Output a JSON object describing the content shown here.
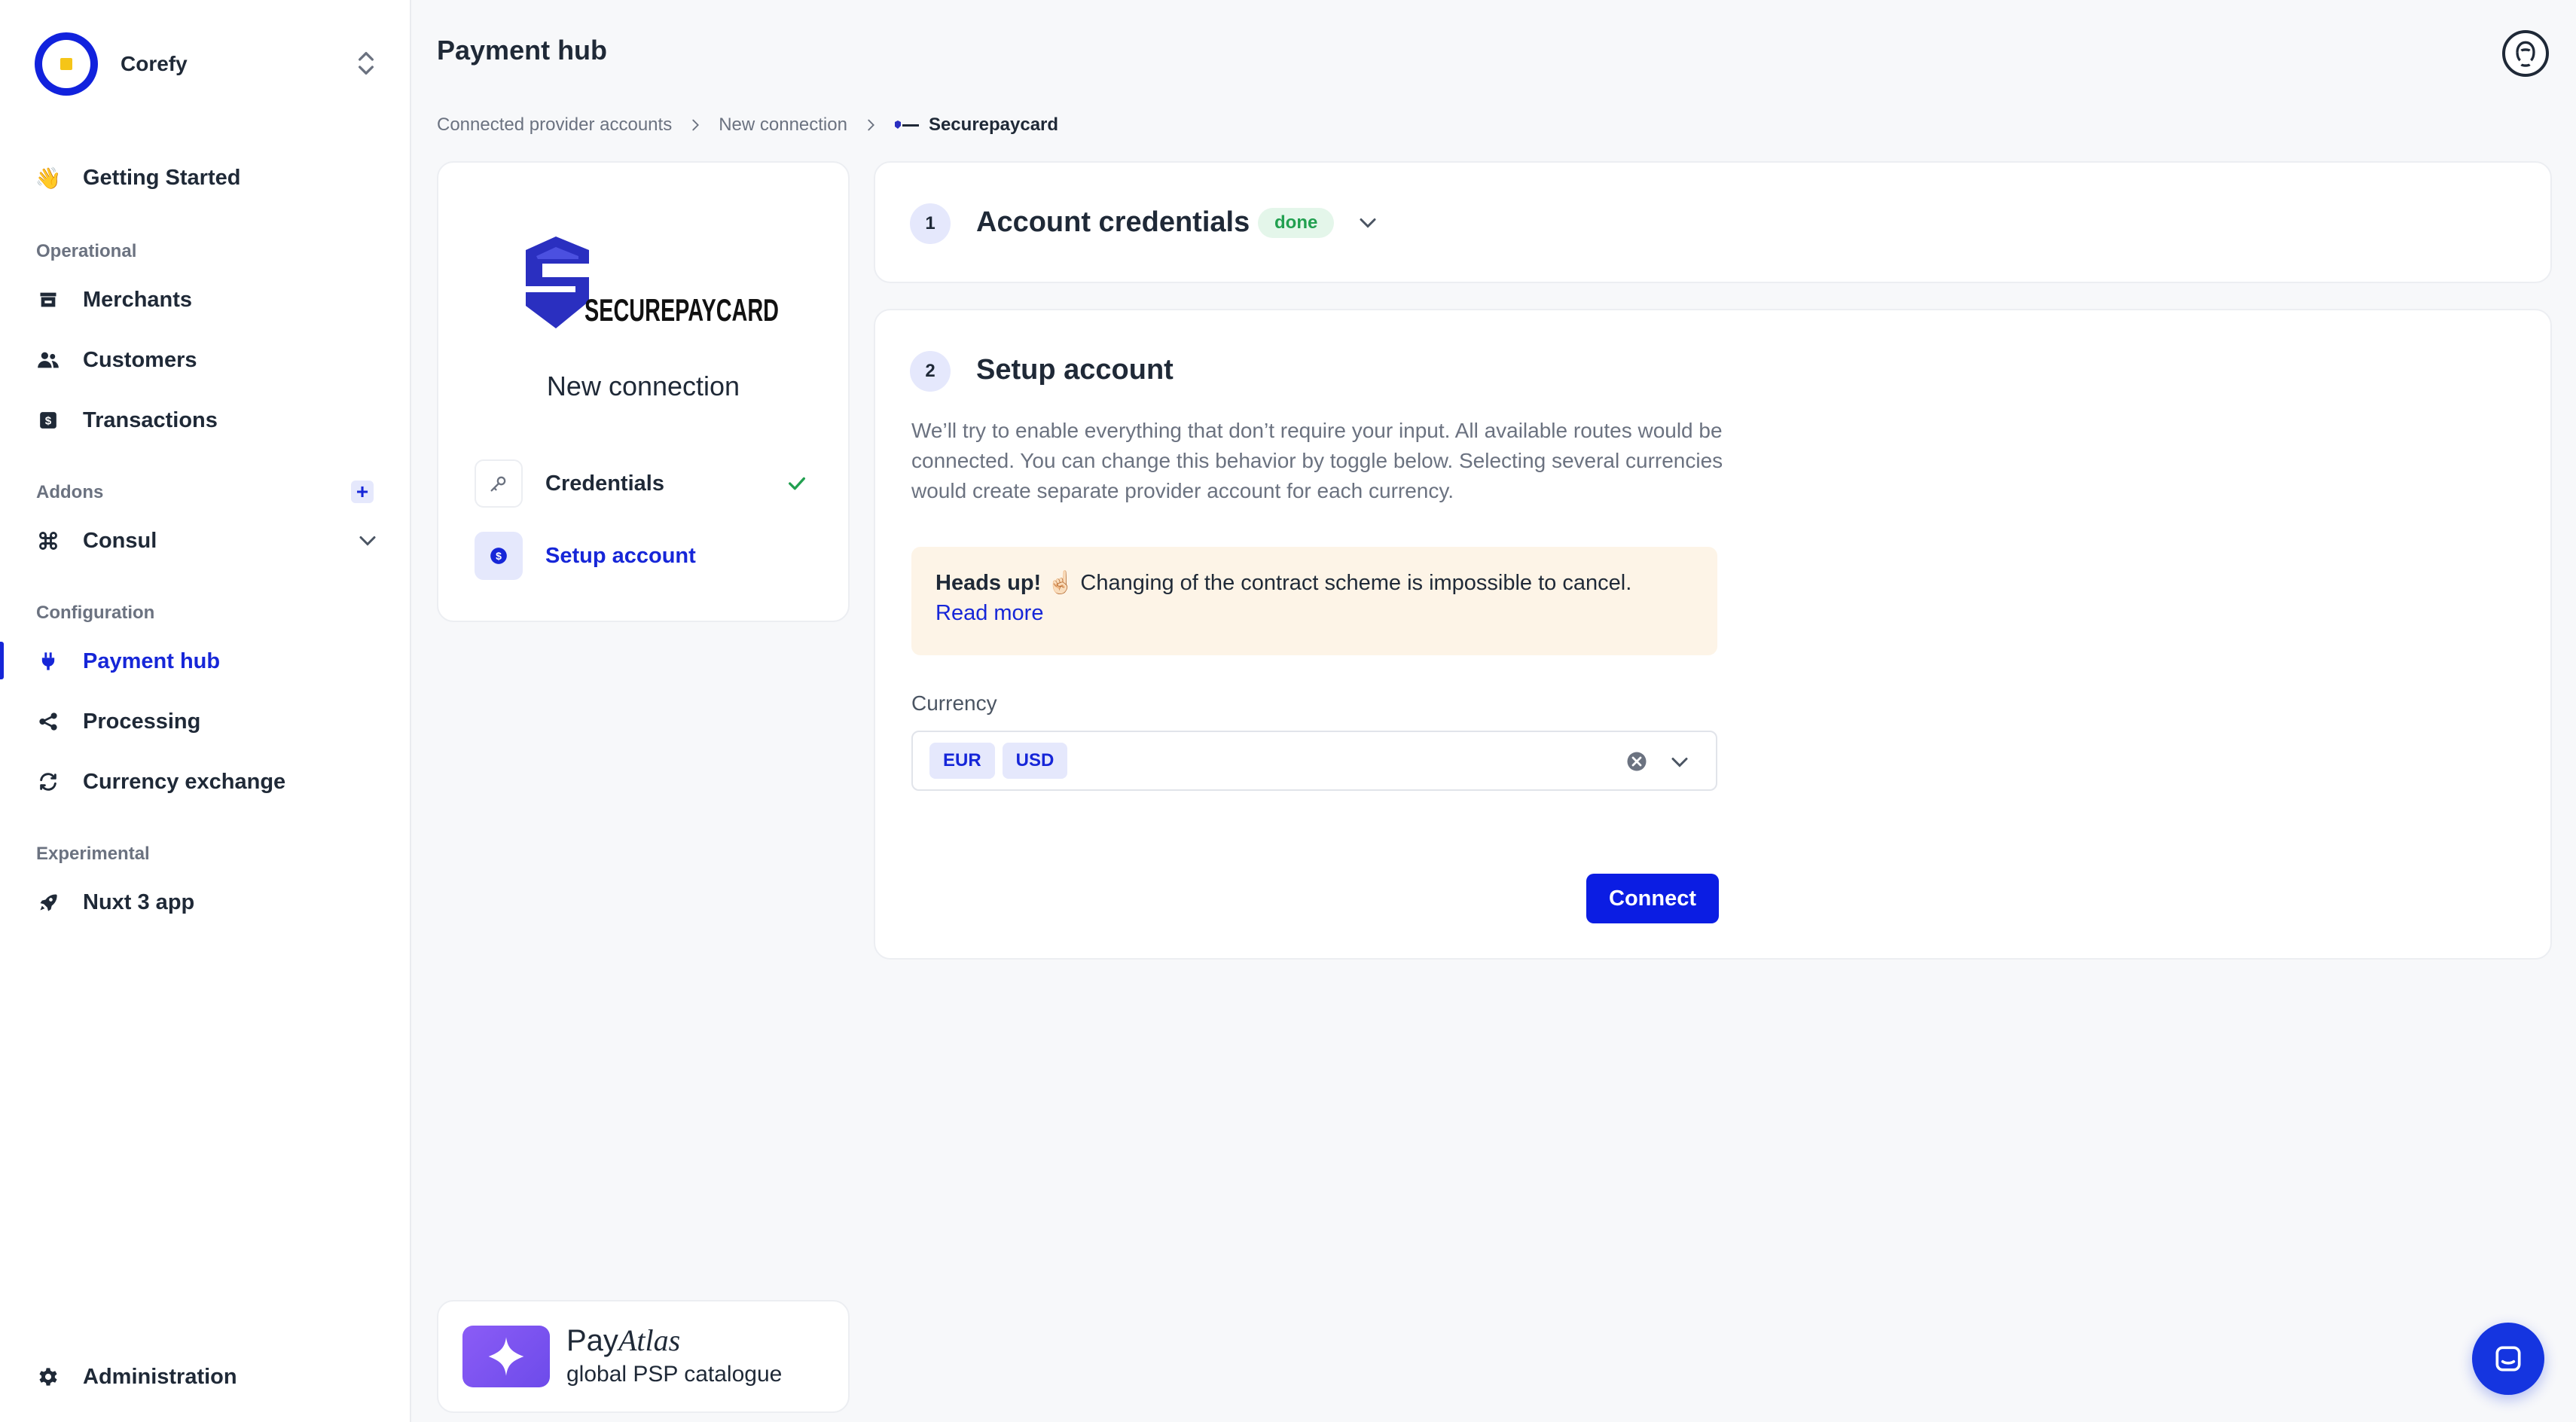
{
  "org": {
    "name": "Corefy"
  },
  "sidebar": {
    "getting_started": "Getting Started",
    "sections": {
      "operational": "Operational",
      "addons": "Addons",
      "configuration": "Configuration",
      "experimental": "Experimental"
    },
    "items": {
      "merchants": "Merchants",
      "customers": "Customers",
      "transactions": "Transactions",
      "consul": "Consul",
      "payment_hub": "Payment hub",
      "processing": "Processing",
      "currency_exchange": "Currency exchange",
      "nuxt": "Nuxt 3 app",
      "administration": "Administration"
    },
    "active_item": "payment_hub"
  },
  "header": {
    "title": "Payment hub"
  },
  "breadcrumb": {
    "items": [
      "Connected provider accounts",
      "New connection"
    ],
    "current": "Securepaycard"
  },
  "left_card": {
    "brand_text": "SECUREPAYCARD",
    "title": "New connection",
    "steps": [
      {
        "label": "Credentials",
        "icon": "key-icon",
        "status": "done"
      },
      {
        "label": "Setup account",
        "icon": "dollar-icon",
        "status": "active"
      }
    ]
  },
  "account_credentials": {
    "number": "1",
    "title": "Account credentials",
    "badge": "done"
  },
  "setup_account": {
    "number": "2",
    "title": "Setup account",
    "description": "We’ll try to enable everything that don’t require your input. All available routes would be connected. You can change this behavior by toggle below. Selecting several currencies would create separate provider account for each currency.",
    "alert": {
      "strong": "Heads up!",
      "emoji": "☝🏻",
      "text": "Changing of the contract scheme is impossible to cancel.",
      "link": "Read more"
    },
    "currency": {
      "label": "Currency",
      "selected": [
        "EUR",
        "USD"
      ]
    },
    "connect_label": "Connect"
  },
  "payatlas": {
    "name_regular": "Pay",
    "name_italic": "Atlas",
    "subtitle": "global PSP catalogue"
  },
  "colors": {
    "accent": "#1626d8",
    "button": "#0b1de3",
    "success": "#22a050",
    "alert_bg": "#fdf4e7"
  }
}
